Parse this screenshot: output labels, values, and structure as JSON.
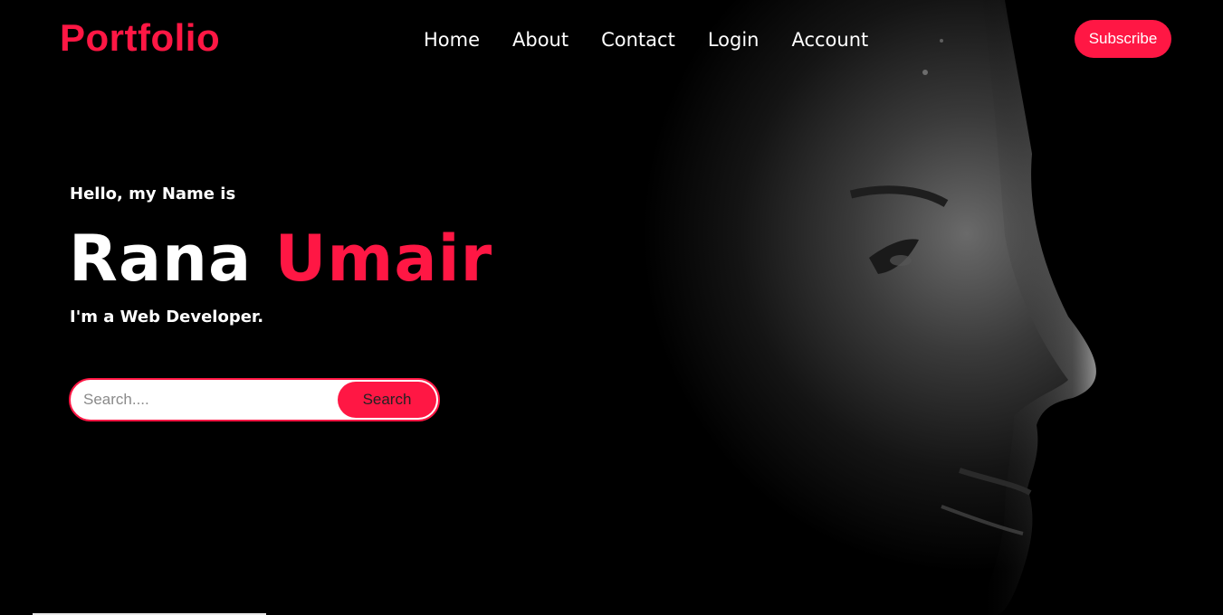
{
  "header": {
    "logo": "Portfolio",
    "nav": [
      {
        "label": "Home"
      },
      {
        "label": "About"
      },
      {
        "label": "Contact"
      },
      {
        "label": "Login"
      },
      {
        "label": "Account"
      }
    ],
    "subscribe_label": "Subscribe"
  },
  "hero": {
    "greeting": "Hello, my Name is",
    "first_name": "Rana",
    "last_name": "Umair",
    "role": "I'm a Web Developer.",
    "background_image": "man-face-profile-dark-photo"
  },
  "search": {
    "placeholder": "Search....",
    "value": "",
    "button_label": "Search"
  },
  "colors": {
    "accent": "#ff1744",
    "background": "#000000",
    "text": "#ffffff"
  }
}
